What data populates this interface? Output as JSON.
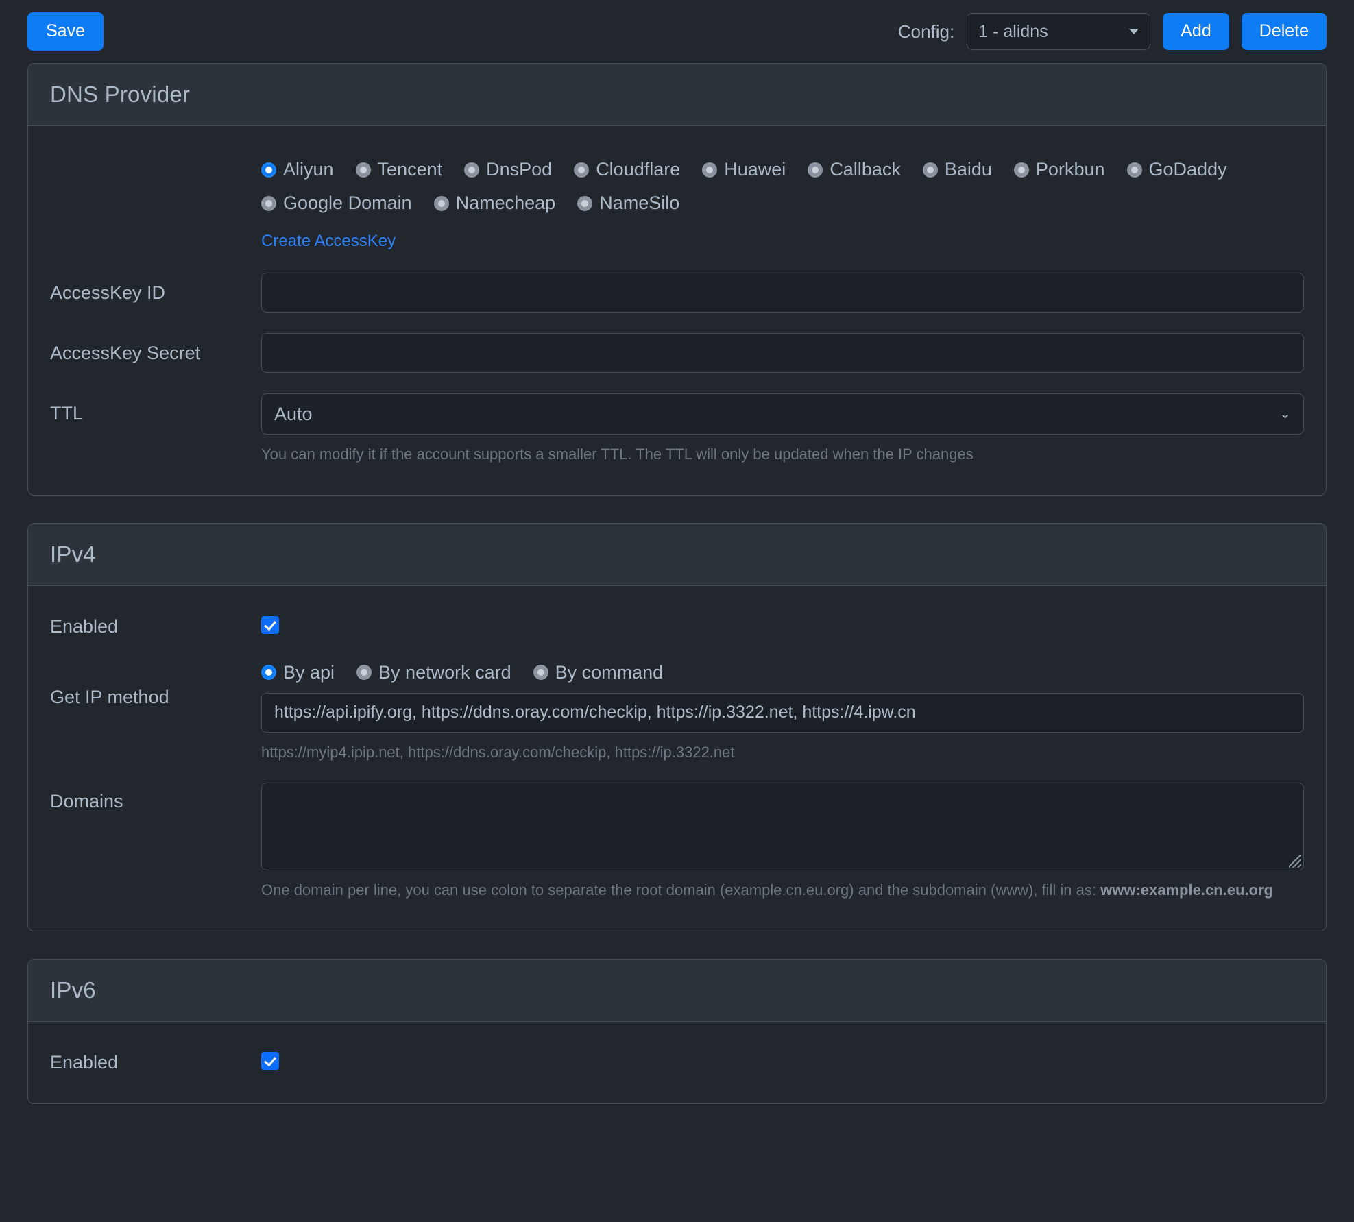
{
  "colors": {
    "page_bg": "#22272e",
    "card_border": "#444c56",
    "card_header_bg": "#2d333b",
    "accent": "#0d7cf5",
    "link": "#2f81f7",
    "text": "#adbac7",
    "hint": "#6e7681",
    "input_bg": "#1c2128",
    "checkbox": "#0d6efd"
  },
  "toolbar": {
    "save_label": "Save",
    "config_label": "Config:",
    "config_selected": "1 - alidns",
    "config_options": [
      "1 - alidns"
    ],
    "add_label": "Add",
    "delete_label": "Delete",
    "chevron_icon": "chevron-down-icon"
  },
  "dns_provider": {
    "title": "DNS Provider",
    "providers_row1": [
      {
        "label": "Aliyun",
        "checked": true
      },
      {
        "label": "Tencent",
        "checked": false
      },
      {
        "label": "DnsPod",
        "checked": false
      },
      {
        "label": "Cloudflare",
        "checked": false
      },
      {
        "label": "Huawei",
        "checked": false
      },
      {
        "label": "Callback",
        "checked": false
      },
      {
        "label": "Baidu",
        "checked": false
      },
      {
        "label": "Porkbun",
        "checked": false
      },
      {
        "label": "GoDaddy",
        "checked": false
      }
    ],
    "providers_row2": [
      {
        "label": "Google Domain",
        "checked": false
      },
      {
        "label": "Namecheap",
        "checked": false
      },
      {
        "label": "NameSilo",
        "checked": false
      }
    ],
    "create_accesskey_link": "Create AccessKey",
    "accesskey_id": {
      "label": "AccessKey ID",
      "value": "",
      "placeholder": ""
    },
    "accesskey_secret": {
      "label": "AccessKey Secret",
      "value": "",
      "placeholder": ""
    },
    "ttl": {
      "label": "TTL",
      "selected": "Auto",
      "options": [
        "Auto"
      ],
      "hint": "You can modify it if the account supports a smaller TTL. The TTL will only be updated when the IP changes"
    }
  },
  "ipv4": {
    "title": "IPv4",
    "enabled": {
      "label": "Enabled",
      "checked": true
    },
    "get_ip_method": {
      "label": "Get IP method",
      "options": [
        {
          "label": "By api",
          "checked": true
        },
        {
          "label": "By network card",
          "checked": false
        },
        {
          "label": "By command",
          "checked": false
        }
      ],
      "value": "https://api.ipify.org, https://ddns.oray.com/checkip, https://ip.3322.net, https://4.ipw.cn",
      "placeholder": "",
      "hint": "https://myip4.ipip.net, https://ddns.oray.com/checkip, https://ip.3322.net"
    },
    "domains": {
      "label": "Domains",
      "value": "",
      "placeholder": "",
      "hint_prefix": "One domain per line, you can use colon to separate the root domain (example.cn.eu.org) and the subdomain (www), fill in as: ",
      "hint_bold": "www:example.cn.eu.org"
    }
  },
  "ipv6": {
    "title": "IPv6",
    "enabled": {
      "label": "Enabled",
      "checked": true
    }
  }
}
